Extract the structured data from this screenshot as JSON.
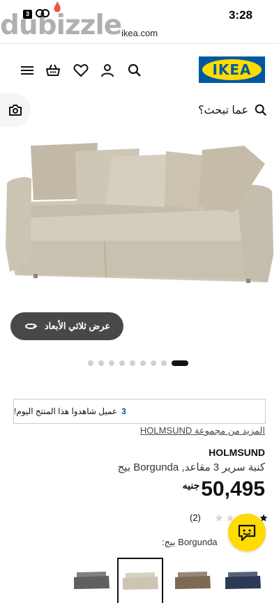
{
  "status_bar": {
    "time": "3:28",
    "url": "ikea.com",
    "notification_badge": "3",
    "watermark": "dubizzle"
  },
  "header": {
    "logo_text": "IKEA",
    "icons": [
      "menu-icon",
      "basket-icon",
      "heart-icon",
      "user-icon",
      "search-icon"
    ]
  },
  "search": {
    "placeholder": "عما تبحث؟"
  },
  "gallery": {
    "view_3d_label": "عرض ثلاثي الأبعاد",
    "dot_count": 9,
    "active_dot": 8
  },
  "viewers": {
    "count": "3",
    "text": "عميل شاهدوا هذا المنتج اليوم!"
  },
  "product": {
    "collection_link": "المزيد من مجموعة HOLMSUND",
    "name": "HOLMSUND",
    "description": "كنبة سرير 3 مقاعد, Borgunda بيج",
    "price": "50,495",
    "currency": "جنيه",
    "rating_count": "(2)",
    "rating_value": 3,
    "rating_max": 5,
    "color_label": "Borgunda بيج:"
  },
  "colors": {
    "brand_blue": "#0058a3",
    "brand_yellow": "#ffdb00",
    "swatches": [
      "#5e6062",
      "#cdc5b4",
      "#7c6a55",
      "#2c3a55"
    ],
    "selected_swatch": 1
  }
}
